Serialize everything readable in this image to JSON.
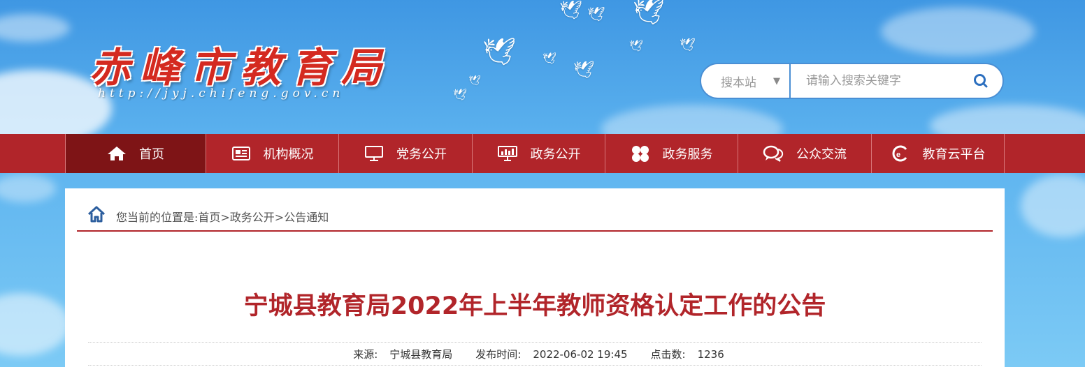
{
  "site": {
    "logo_text": "赤峰市教育局",
    "logo_url": "http://jyj.chifeng.gov.cn"
  },
  "search": {
    "scope_label": "搜本站",
    "placeholder": "请输入搜索关键字"
  },
  "nav": {
    "items": [
      {
        "label": "首页",
        "icon": "home-icon"
      },
      {
        "label": "机构概况",
        "icon": "newspaper-icon"
      },
      {
        "label": "党务公开",
        "icon": "monitor-icon"
      },
      {
        "label": "政务公开",
        "icon": "presentation-icon"
      },
      {
        "label": "政务服务",
        "icon": "grid-icon"
      },
      {
        "label": "公众交流",
        "icon": "chat-icon"
      },
      {
        "label": "教育云平台",
        "icon": "cloud-icon"
      }
    ]
  },
  "breadcrumb": {
    "text": "您当前的位置是:首页>政务公开>公告通知"
  },
  "article": {
    "title": "宁城县教育局2022年上半年教师资格认定工作的公告",
    "source_label": "来源:",
    "source": "宁城县教育局",
    "time_label": "发布时间:",
    "time": "2022-06-02 19:45",
    "clicks_label": "点击数:",
    "clicks": "1236"
  },
  "colors": {
    "brand_red": "#b1252a",
    "active_nav": "#7e1416",
    "sky_blue": "#5db3ef"
  }
}
